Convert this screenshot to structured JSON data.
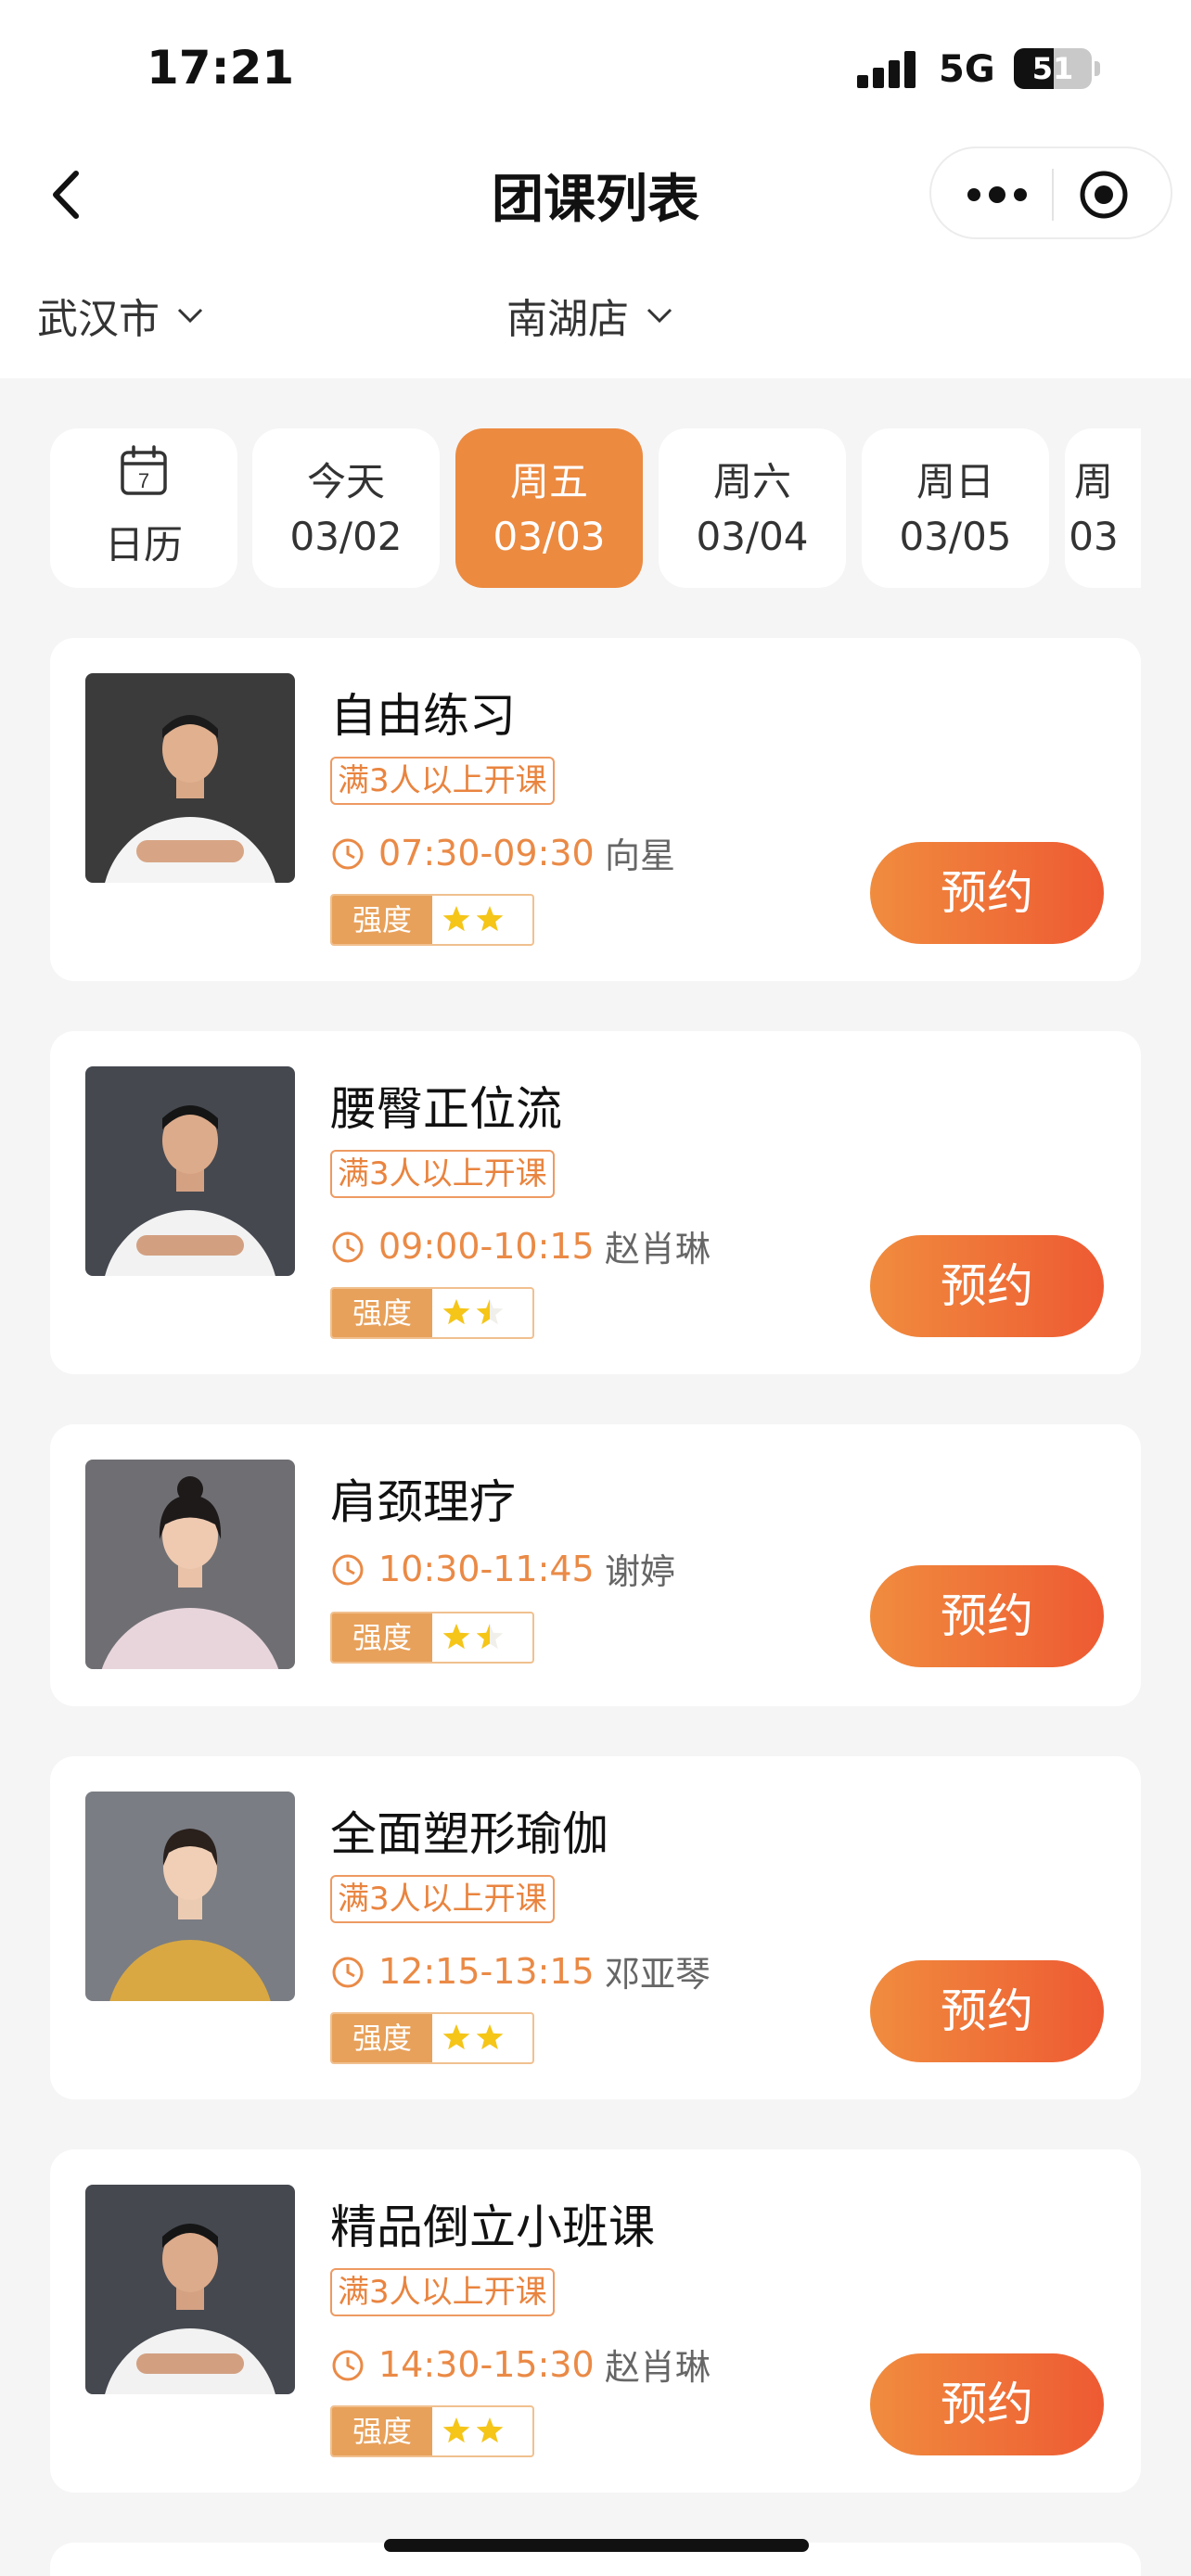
{
  "status": {
    "time": "17:21",
    "network": "5G",
    "battery": "51"
  },
  "header": {
    "title": "团课列表"
  },
  "filters": {
    "city": "武汉市",
    "store": "南湖店"
  },
  "dates": [
    {
      "l1": "",
      "l2": "日历",
      "icon": "calendar-icon",
      "icon_day": "7",
      "active": false
    },
    {
      "l1": "今天",
      "l2": "03/02",
      "active": false
    },
    {
      "l1": "周五",
      "l2": "03/03",
      "active": true
    },
    {
      "l1": "周六",
      "l2": "03/04",
      "active": false
    },
    {
      "l1": "周日",
      "l2": "03/05",
      "active": false
    },
    {
      "l1": "周",
      "l2": "03",
      "active": false
    }
  ],
  "intensity_label": "强度",
  "book_label": "预约",
  "courses": [
    {
      "name": "自由练习",
      "tag": "满3人以上开课",
      "time": "07:30-09:30",
      "coach": "向星",
      "stars": 2
    },
    {
      "name": "腰臀正位流",
      "tag": "满3人以上开课",
      "time": "09:00-10:15",
      "coach": "赵肖琳",
      "stars": 1.5
    },
    {
      "name": "肩颈理疗",
      "tag": "",
      "time": "10:30-11:45",
      "coach": "谢婷",
      "stars": 1.5
    },
    {
      "name": "全面塑形瑜伽",
      "tag": "满3人以上开课",
      "time": "12:15-13:15",
      "coach": "邓亚琴",
      "stars": 2
    },
    {
      "name": "精品倒立小班课",
      "tag": "满3人以上开课",
      "time": "14:30-15:30",
      "coach": "赵肖琳",
      "stars": 2
    }
  ],
  "colors": {
    "accent": "#ec8a40",
    "button_start": "#f08c3e",
    "button_end": "#ee5a33",
    "star": "#f5c518"
  }
}
